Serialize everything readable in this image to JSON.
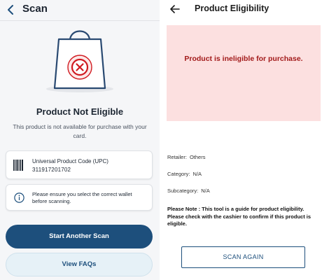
{
  "left_screen": {
    "header": {
      "title": "Scan"
    },
    "status": {
      "title": "Product Not Eligible",
      "description": "This product is not available for purchase with your card."
    },
    "upc_card": {
      "label": "Universal Product Code (UPC)",
      "value": "311917201702"
    },
    "info_card": {
      "text": "Please ensure you select the correct wallet before scanning."
    },
    "buttons": {
      "start_another_scan": "Start Another Scan",
      "view_faqs": "View FAQs"
    }
  },
  "right_screen": {
    "header": {
      "title": "Product Eligibility"
    },
    "banner": {
      "text": "Product is ineligible for purchase."
    },
    "details": {
      "retailer_label": "Retailer:",
      "retailer_value": "Others",
      "category_label": "Category:",
      "category_value": "N/A",
      "subcategory_label": "Subcategory:",
      "subcategory_value": "N/A"
    },
    "note": "Please Note : This tool is a guide for product eligibility. Please check with the cashier to confirm if this product is eligible.",
    "scan_again_button": "SCAN AGAIN"
  },
  "icons": [
    "back-chevron-icon",
    "shopping-bag-icon",
    "not-eligible-x-icon",
    "barcode-icon",
    "info-icon",
    "back-arrow-icon"
  ],
  "colors": {
    "primary": "#1d4f7c",
    "error_text": "#a21a1a",
    "error_background": "#fce0e0",
    "error_icon": "#d0191f"
  }
}
